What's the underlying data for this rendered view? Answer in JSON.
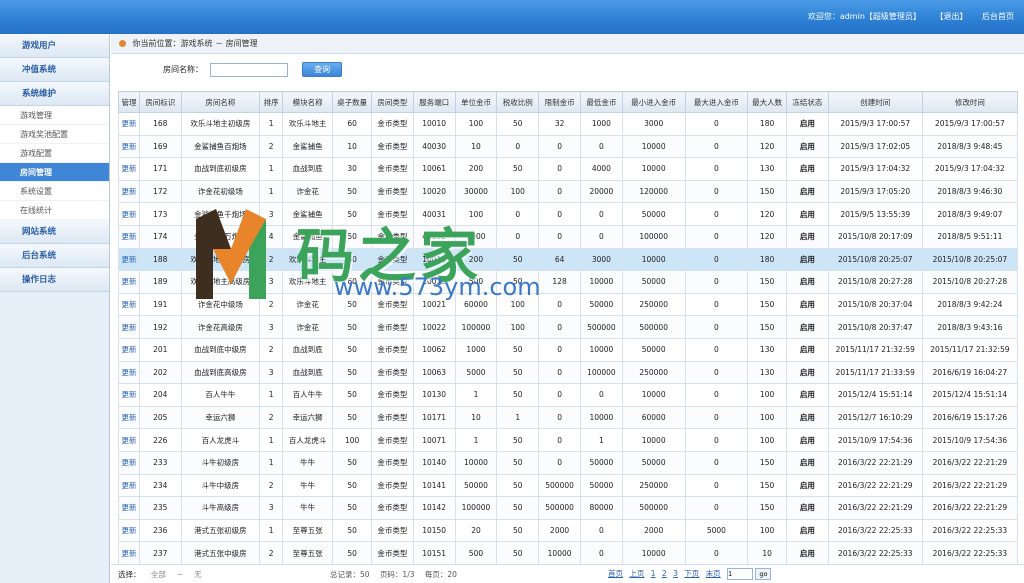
{
  "header": {
    "welcome": "欢迎您：admin【超级管理员】",
    "logout": "【退出】",
    "home": "后台首页"
  },
  "sidebar": {
    "groups_top": [
      "游戏用户",
      "冲值系统",
      "系统维护"
    ],
    "subs": [
      "游戏管理",
      "游戏奖池配置",
      "游戏配置",
      "房间管理",
      "系统设置",
      "在线统计"
    ],
    "active_sub": "房间管理",
    "groups_bottom": [
      "网站系统",
      "后台系统",
      "操作日志"
    ]
  },
  "breadcrumb": "你当前位置：游戏系统 － 房间管理",
  "search": {
    "label": "房间名称：",
    "value": "",
    "button": "查询"
  },
  "table": {
    "headers": [
      "管理",
      "房间标识",
      "房间名称",
      "排序",
      "模块名称",
      "桌子数量",
      "房间类型",
      "服务端口",
      "单位金币",
      "税收比例",
      "限制金币",
      "最低金币",
      "最小进入金币",
      "最大进入金币",
      "最大人数",
      "冻结状态",
      "创建时间",
      "修改时间"
    ],
    "highlight_index": 6,
    "rows": [
      [
        "更新",
        "168",
        "欢乐斗地主初级房",
        "1",
        "欢乐斗地主",
        "60",
        "金币类型",
        "10010",
        "100",
        "50",
        "32",
        "1000",
        "3000",
        "0",
        "180",
        "启用",
        "2015/9/3 17:00:57",
        "2015/9/3 17:00:57"
      ],
      [
        "更新",
        "169",
        "金鲨捕鱼百炮场",
        "2",
        "金鲨捕鱼",
        "10",
        "金币类型",
        "40030",
        "10",
        "0",
        "0",
        "0",
        "10000",
        "0",
        "120",
        "启用",
        "2015/9/3 17:02:05",
        "2018/8/3 9:48:45"
      ],
      [
        "更新",
        "171",
        "血战到底初级房",
        "1",
        "血战到底",
        "30",
        "金币类型",
        "10061",
        "200",
        "50",
        "0",
        "4000",
        "10000",
        "0",
        "130",
        "启用",
        "2015/9/3 17:04:32",
        "2015/9/3 17:04:32"
      ],
      [
        "更新",
        "172",
        "诈金花初级场",
        "1",
        "诈金花",
        "50",
        "金币类型",
        "10020",
        "30000",
        "100",
        "0",
        "20000",
        "120000",
        "0",
        "150",
        "启用",
        "2015/9/3 17:05:20",
        "2018/8/3 9:46:30"
      ],
      [
        "更新",
        "173",
        "金鲨捕鱼千炮场",
        "3",
        "金鲨捕鱼",
        "50",
        "金币类型",
        "40031",
        "100",
        "0",
        "0",
        "0",
        "50000",
        "0",
        "120",
        "启用",
        "2015/9/5 13:55:39",
        "2018/8/3 9:49:07"
      ],
      [
        "更新",
        "174",
        "金鲨捕鱼万炮场",
        "4",
        "金鲨捕鱼",
        "50",
        "金币类型",
        "40032",
        "1000",
        "0",
        "0",
        "0",
        "100000",
        "0",
        "120",
        "启用",
        "2015/10/8 20:17:09",
        "2018/8/5 9:51:11"
      ],
      [
        "更新",
        "188",
        "欢乐斗地主中级房",
        "2",
        "欢乐斗地主",
        "60",
        "金币类型",
        "10011",
        "200",
        "50",
        "64",
        "3000",
        "10000",
        "0",
        "180",
        "启用",
        "2015/10/8 20:25:07",
        "2015/10/8 20:25:07"
      ],
      [
        "更新",
        "189",
        "欢乐斗地主高级房",
        "3",
        "欢乐斗地主",
        "60",
        "金币类型",
        "10012",
        "500",
        "50",
        "128",
        "10000",
        "50000",
        "0",
        "150",
        "启用",
        "2015/10/8 20:27:28",
        "2015/10/8 20:27:28"
      ],
      [
        "更新",
        "191",
        "诈金花中级场",
        "2",
        "诈金花",
        "50",
        "金币类型",
        "10021",
        "60000",
        "100",
        "0",
        "50000",
        "250000",
        "0",
        "150",
        "启用",
        "2015/10/8 20:37:04",
        "2018/8/3 9:42:24"
      ],
      [
        "更新",
        "192",
        "诈金花高级房",
        "3",
        "诈金花",
        "50",
        "金币类型",
        "10022",
        "100000",
        "100",
        "0",
        "500000",
        "500000",
        "0",
        "150",
        "启用",
        "2015/10/8 20:37:47",
        "2018/8/3 9:43:16"
      ],
      [
        "更新",
        "201",
        "血战到底中级房",
        "2",
        "血战到底",
        "50",
        "金币类型",
        "10062",
        "1000",
        "50",
        "0",
        "10000",
        "50000",
        "0",
        "130",
        "启用",
        "2015/11/17 21:32:59",
        "2015/11/17 21:32:59"
      ],
      [
        "更新",
        "202",
        "血战到底高级房",
        "3",
        "血战到底",
        "50",
        "金币类型",
        "10063",
        "5000",
        "50",
        "0",
        "100000",
        "250000",
        "0",
        "130",
        "启用",
        "2015/11/17 21:33:59",
        "2016/6/19 16:04:27"
      ],
      [
        "更新",
        "204",
        "百人牛牛",
        "1",
        "百人牛牛",
        "50",
        "金币类型",
        "10130",
        "1",
        "50",
        "0",
        "0",
        "10000",
        "0",
        "100",
        "启用",
        "2015/12/4 15:51:14",
        "2015/12/4 15:51:14"
      ],
      [
        "更新",
        "205",
        "幸运六狮",
        "2",
        "幸运六狮",
        "50",
        "金币类型",
        "10171",
        "10",
        "1",
        "0",
        "10000",
        "60000",
        "0",
        "100",
        "启用",
        "2015/12/7 16:10:29",
        "2016/6/19 15:17:26"
      ],
      [
        "更新",
        "226",
        "百人龙虎斗",
        "1",
        "百人龙虎斗",
        "100",
        "金币类型",
        "10071",
        "1",
        "50",
        "0",
        "1",
        "10000",
        "0",
        "100",
        "启用",
        "2015/10/9 17:54:36",
        "2015/10/9 17:54:36"
      ],
      [
        "更新",
        "233",
        "斗牛初级房",
        "1",
        "牛牛",
        "50",
        "金币类型",
        "10140",
        "10000",
        "50",
        "0",
        "50000",
        "50000",
        "0",
        "150",
        "启用",
        "2016/3/22 22:21:29",
        "2016/3/22 22:21:29"
      ],
      [
        "更新",
        "234",
        "斗牛中级房",
        "2",
        "牛牛",
        "50",
        "金币类型",
        "10141",
        "50000",
        "50",
        "500000",
        "50000",
        "250000",
        "0",
        "150",
        "启用",
        "2016/3/22 22:21:29",
        "2016/3/22 22:21:29"
      ],
      [
        "更新",
        "235",
        "斗牛高级房",
        "3",
        "牛牛",
        "50",
        "金币类型",
        "10142",
        "100000",
        "50",
        "500000",
        "80000",
        "500000",
        "0",
        "150",
        "启用",
        "2016/3/22 22:21:29",
        "2016/3/22 22:21:29"
      ],
      [
        "更新",
        "236",
        "港式五张初级房",
        "1",
        "至尊五张",
        "50",
        "金币类型",
        "10150",
        "20",
        "50",
        "2000",
        "0",
        "2000",
        "5000",
        "100",
        "启用",
        "2016/3/22 22:25:33",
        "2016/3/22 22:25:33"
      ],
      [
        "更新",
        "237",
        "港式五张中级房",
        "2",
        "至尊五张",
        "50",
        "金币类型",
        "10151",
        "500",
        "50",
        "10000",
        "0",
        "10000",
        "0",
        "10",
        "启用",
        "2016/3/22 22:25:33",
        "2016/3/22 22:25:33"
      ]
    ]
  },
  "footer": {
    "select_label": "选择：",
    "select_all": "全部",
    "select_sep": "－",
    "select_none": "无",
    "total": "总记录：50",
    "page_info": "页码：1/3",
    "per_page": "每页：20",
    "first": "首页",
    "prev": "上页",
    "pages": [
      "1",
      "2",
      "3"
    ],
    "next": "下页",
    "last": "末页",
    "goto_value": "1",
    "go_label": "go"
  },
  "watermark": {
    "text": "码之家",
    "url": "www.573ym.com"
  },
  "colors": {
    "header": "#2c7fd4",
    "active_nav": "#3f86d6",
    "highlight_row": "#cde6f7",
    "watermark_green": "#3ba35a",
    "watermark_orange": "#e8842a"
  }
}
